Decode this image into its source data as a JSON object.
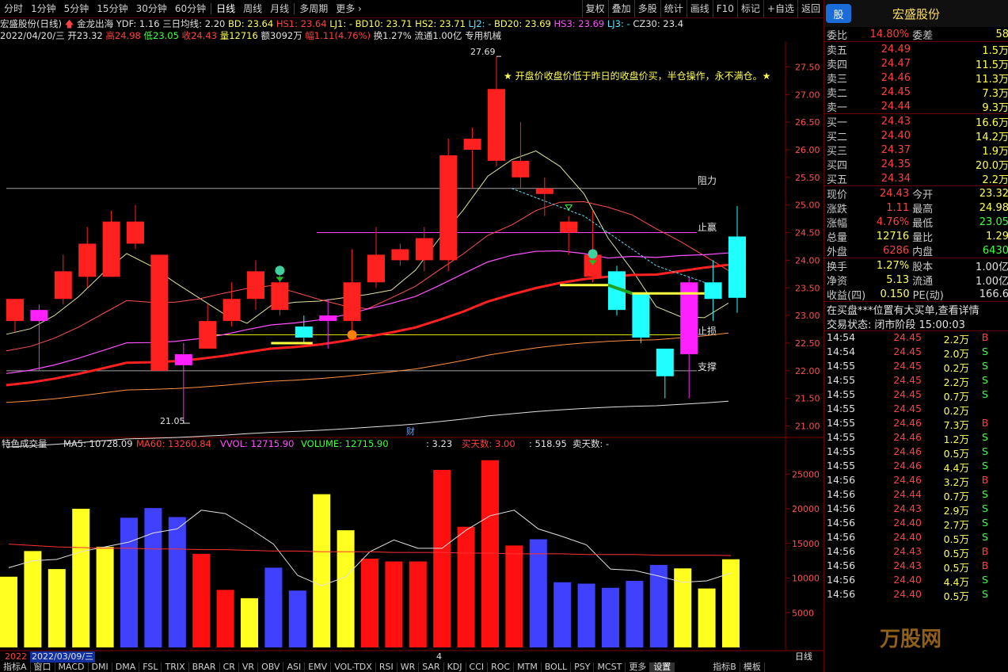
{
  "top_tabs": [
    "分时",
    "1分钟",
    "5分钟",
    "15分钟",
    "30分钟",
    "60分钟",
    "日线",
    "周线",
    "月线",
    "多周期",
    "更多"
  ],
  "active_tab": "日线",
  "top_tools": [
    "复权",
    "叠加",
    "多股",
    "统计",
    "画线",
    "F10",
    "标记",
    "+自选",
    "返回"
  ],
  "info1": {
    "name": "宏盛股份(日线)",
    "indicator": "金龙出海",
    "ydf": "YDF: 1.16",
    "sanri": "三日均线: 2.20",
    "bd": "BD: 23.64",
    "hs1": "HS1: 23.64",
    "lj1": "LJ1: -",
    "bd10": "BD10: 23.71",
    "hs2": "HS2: 23.71",
    "lj2": "LJ2: -",
    "bd20": "BD20: 23.69",
    "hs3": "HS3: 23.69",
    "lj3": "LJ3: -",
    "cz30": "CZ30: 23.4"
  },
  "info2": {
    "date": "2022/04/20/三",
    "open": "开23.32",
    "high": "高24.98",
    "low": "低23.05",
    "close": "收24.43",
    "vol": "量12716",
    "amount": "额3092万",
    "change": "幅1.11(4.76%)",
    "turnover": "换1.27%",
    "float": "流通1.00亿",
    "industry": "专用机械"
  },
  "annotation": "★ 开盘价收盘价低于昨日的收盘价买，半仓操作，永不满仓。★",
  "levels": {
    "resist": "阻力",
    "stopwin": "止赢",
    "stoploss": "止损",
    "support": "支撑"
  },
  "hi_label": "27.69",
  "lo_label": "21.05",
  "cai_label": "财",
  "price_axis": [
    "27.50",
    "27.00",
    "26.50",
    "26.00",
    "25.50",
    "25.00",
    "24.50",
    "24.00",
    "23.50",
    "23.00",
    "22.50",
    "22.00",
    "21.50",
    "21.00"
  ],
  "vol_axis": [
    "25000",
    "20000",
    "15000",
    "10000",
    "5000"
  ],
  "vol_info": {
    "name": "特色成交量",
    "ma5": "MA5: 10728.09",
    "ma60": "MA60: 13260.84",
    "vvol": "VVOL: 12715.90",
    "volume": "VOLUME: 12715.90",
    "v1": ": 3.23",
    "buy_days": "买天数: 3.00",
    "v2": ": 518.95",
    "sell_days": "卖天数: -"
  },
  "date_bar": {
    "left": "2022",
    "sel": "2022/03/09/三",
    "mid": "4",
    "axis": "日线"
  },
  "bottom_tabs": [
    "指标A",
    "窗口",
    "MACD",
    "DMI",
    "DMA",
    "FSL",
    "TRIX",
    "BRAR",
    "CR",
    "VR",
    "OBV",
    "ASI",
    "EMV",
    "VOL-TDX",
    "RSI",
    "WR",
    "SAR",
    "KDJ",
    "CCI",
    "ROC",
    "MTM",
    "BOLL",
    "PSY",
    "MCST",
    "更多",
    "设置",
    "指标B",
    "模板"
  ],
  "right": {
    "logo": "股",
    "title": "宏盛股份",
    "weibi_label": "委比",
    "weibi": "14.80%",
    "weicha_label": "委差",
    "weicha": "58",
    "asks": [
      [
        "卖五",
        "24.49",
        "1.5万"
      ],
      [
        "卖四",
        "24.47",
        "11.5万"
      ],
      [
        "卖三",
        "24.46",
        "11.3万"
      ],
      [
        "卖二",
        "24.45",
        "7.3万"
      ],
      [
        "卖一",
        "24.44",
        "9.3万"
      ]
    ],
    "bids": [
      [
        "买一",
        "24.43",
        "16.6万"
      ],
      [
        "买二",
        "24.40",
        "14.2万"
      ],
      [
        "买三",
        "24.37",
        "1.9万"
      ],
      [
        "买四",
        "24.35",
        "20.0万"
      ],
      [
        "买五",
        "24.34",
        "2.2万"
      ]
    ],
    "stats": [
      [
        "现价",
        "24.43",
        "今开",
        "23.32"
      ],
      [
        "涨跌",
        "1.11",
        "最高",
        "24.98"
      ],
      [
        "涨幅",
        "4.76%",
        "最低",
        "23.05"
      ],
      [
        "总量",
        "12716",
        "量比",
        "1.29"
      ],
      [
        "外盘",
        "6286",
        "内盘",
        "6430"
      ]
    ],
    "stats2": [
      [
        "换手",
        "1.27%",
        "股本",
        "1.00亿"
      ],
      [
        "净资",
        "5.13",
        "流通",
        "1.00亿"
      ],
      [
        "收益(四)",
        "0.150",
        "PE(动)",
        "166.6"
      ]
    ],
    "notice": "在买盘***位置有大买单,查看详情",
    "status_label": "交易状态:",
    "status": "闭市阶段 15:00:03",
    "ticks": [
      [
        "14:54",
        "24.45",
        "2.2万",
        "B"
      ],
      [
        "14:54",
        "24.45",
        "2.0万",
        "S"
      ],
      [
        "14:55",
        "24.45",
        "0.2万",
        "S"
      ],
      [
        "14:55",
        "24.45",
        "2.2万",
        "S"
      ],
      [
        "14:55",
        "24.45",
        "0.7万",
        "S"
      ],
      [
        "14:55",
        "24.45",
        "0.2万",
        ""
      ],
      [
        "14:55",
        "24.46",
        "7.3万",
        "B"
      ],
      [
        "14:55",
        "24.46",
        "1.2万",
        "S"
      ],
      [
        "14:55",
        "24.46",
        "0.5万",
        "S"
      ],
      [
        "14:55",
        "24.46",
        "4.4万",
        "S"
      ],
      [
        "14:56",
        "24.46",
        "3.2万",
        "B"
      ],
      [
        "14:56",
        "24.44",
        "0.7万",
        "S"
      ],
      [
        "14:56",
        "24.43",
        "2.9万",
        "S"
      ],
      [
        "14:56",
        "24.40",
        "2.7万",
        "S"
      ],
      [
        "14:56",
        "24.40",
        "0.5万",
        "S"
      ],
      [
        "14:56",
        "24.43",
        "0.5万",
        "B"
      ],
      [
        "14:56",
        "24.43",
        "0.5万",
        "B"
      ],
      [
        "14:56",
        "24.40",
        "4.4万",
        "S"
      ],
      [
        "14:56",
        "24.40",
        "0.5万",
        "S"
      ]
    ],
    "watermark": "万股网"
  },
  "chart_data": {
    "type": "candlestick",
    "price_ylim": [
      20.85,
      27.85
    ],
    "candles": [
      {
        "o": 23.3,
        "c": 22.9,
        "h": 23.3,
        "l": 22.7,
        "v": 10200,
        "vc": "yellow"
      },
      {
        "o": 22.9,
        "c": 23.1,
        "h": 23.2,
        "l": 22.0,
        "v": 13900,
        "vc": "yellow"
      },
      {
        "o": 23.3,
        "c": 23.8,
        "h": 24.1,
        "l": 23.2,
        "v": 11300,
        "vc": "yellow"
      },
      {
        "o": 23.7,
        "c": 24.3,
        "h": 24.6,
        "l": 23.5,
        "v": 20000,
        "vc": "yellow"
      },
      {
        "o": 23.7,
        "c": 24.7,
        "h": 24.9,
        "l": 23.7,
        "v": 14500,
        "vc": "yellow"
      },
      {
        "o": 24.3,
        "c": 24.7,
        "h": 25.0,
        "l": 24.2,
        "v": 18700,
        "vc": "blue"
      },
      {
        "o": 24.1,
        "c": 22.0,
        "h": 24.1,
        "l": 22.0,
        "v": 20100,
        "vc": "blue"
      },
      {
        "o": 22.1,
        "c": 22.3,
        "h": 22.5,
        "l": 21.05,
        "v": 18800,
        "vc": "blue"
      },
      {
        "o": 22.4,
        "c": 22.9,
        "h": 23.2,
        "l": 22.4,
        "v": 13500,
        "vc": "red"
      },
      {
        "o": 22.9,
        "c": 23.3,
        "h": 23.6,
        "l": 22.8,
        "v": 8300,
        "vc": "red"
      },
      {
        "o": 23.3,
        "c": 23.8,
        "h": 24.0,
        "l": 23.1,
        "v": 7100,
        "vc": "yellow"
      },
      {
        "o": 23.1,
        "c": 23.6,
        "h": 23.8,
        "l": 23.0,
        "v": 11500,
        "vc": "blue"
      },
      {
        "o": 22.8,
        "c": 22.6,
        "h": 23.0,
        "l": 22.5,
        "v": 8200,
        "vc": "blue"
      },
      {
        "o": 22.9,
        "c": 23.0,
        "h": 23.3,
        "l": 22.4,
        "v": 22100,
        "vc": "yellow"
      },
      {
        "o": 22.9,
        "c": 23.6,
        "h": 24.2,
        "l": 22.7,
        "v": 16900,
        "vc": "yellow"
      },
      {
        "o": 23.6,
        "c": 24.1,
        "h": 24.6,
        "l": 23.5,
        "v": 12800,
        "vc": "red"
      },
      {
        "o": 24.2,
        "c": 24.0,
        "h": 24.3,
        "l": 23.9,
        "v": 12400,
        "vc": "red"
      },
      {
        "o": 24.0,
        "c": 24.4,
        "h": 24.6,
        "l": 23.8,
        "v": 12400,
        "vc": "red"
      },
      {
        "o": 24.0,
        "c": 25.9,
        "h": 26.2,
        "l": 23.8,
        "v": 25600,
        "vc": "red"
      },
      {
        "o": 26.0,
        "c": 26.2,
        "h": 26.4,
        "l": 25.3,
        "v": 17400,
        "vc": "red"
      },
      {
        "o": 25.8,
        "c": 27.1,
        "h": 27.69,
        "l": 25.7,
        "v": 27000,
        "vc": "red"
      },
      {
        "o": 25.8,
        "c": 25.5,
        "h": 26.5,
        "l": 25.3,
        "v": 14700,
        "vc": "red"
      },
      {
        "o": 25.3,
        "c": 25.2,
        "h": 25.5,
        "l": 24.8,
        "v": 15600,
        "vc": "blue"
      },
      {
        "o": 24.7,
        "c": 24.5,
        "h": 24.8,
        "l": 24.1,
        "v": 9400,
        "vc": "blue"
      },
      {
        "o": 24.1,
        "c": 23.7,
        "h": 24.9,
        "l": 23.6,
        "v": 9200,
        "vc": "blue"
      },
      {
        "o": 23.8,
        "c": 23.1,
        "h": 23.9,
        "l": 23.0,
        "v": 8600,
        "vc": "blue"
      },
      {
        "o": 23.4,
        "c": 22.6,
        "h": 23.4,
        "l": 22.5,
        "v": 9600,
        "vc": "blue"
      },
      {
        "o": 22.4,
        "c": 21.9,
        "h": 22.4,
        "l": 21.5,
        "v": 11900,
        "vc": "blue"
      },
      {
        "o": 22.3,
        "c": 23.6,
        "h": 23.7,
        "l": 21.5,
        "v": 11400,
        "vc": "yellow"
      },
      {
        "o": 23.3,
        "c": 23.6,
        "h": 24.0,
        "l": 22.9,
        "v": 8500,
        "vc": "yellow"
      },
      {
        "o": 23.32,
        "c": 24.43,
        "h": 24.98,
        "l": 23.05,
        "v": 12716,
        "vc": "yellow"
      }
    ],
    "candle_colors": [
      "red",
      "magenta",
      "red",
      "red",
      "red",
      "red",
      "red",
      "magenta",
      "red",
      "red",
      "red",
      "red",
      "cyan",
      "magenta",
      "red",
      "red",
      "red",
      "red",
      "red",
      "red",
      "red",
      "red",
      "red",
      "red",
      "red",
      "cyan",
      "cyan",
      "cyan",
      "magenta",
      "cyan",
      "cyan"
    ],
    "levels": {
      "resist": 25.3,
      "stopwin": 24.5,
      "stoploss": 22.65,
      "support": 22.0
    },
    "vol_ylim": [
      0,
      28000
    ],
    "ma5_vol": [
      11500,
      12500,
      12700,
      13800,
      14500,
      15200,
      16500,
      17100,
      19800,
      19300,
      17200,
      14900,
      10400,
      8900,
      10200,
      13800,
      15500,
      14300,
      14300,
      16900,
      19000,
      19800,
      17100,
      16000,
      14800,
      11300,
      11100,
      10300,
      9400,
      9600,
      10728
    ],
    "ma60_vol": [
      14900,
      14700,
      14500,
      14400,
      14300,
      14300,
      14200,
      14200,
      14100,
      14100,
      14000,
      13900,
      13900,
      13800,
      13800,
      13800,
      13700,
      13700,
      13700,
      13600,
      13600,
      13500,
      13500,
      13500,
      13400,
      13400,
      13400,
      13300,
      13300,
      13300,
      13260
    ]
  }
}
